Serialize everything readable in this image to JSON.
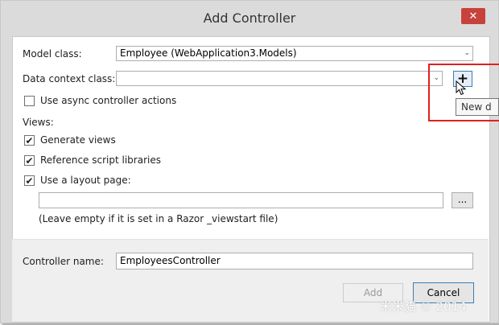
{
  "window": {
    "title": "Add Controller",
    "close_glyph": "✕"
  },
  "model_class": {
    "label": "Model class:",
    "value": "Employee (WebApplication3.Models)"
  },
  "data_context": {
    "label": "Data context class:",
    "value": "",
    "dropdown_glyph": "⌄",
    "new_button_glyph": "+"
  },
  "tooltip": {
    "text": "New d"
  },
  "async_actions": {
    "label": "Use async controller actions",
    "checked": false
  },
  "views": {
    "heading": "Views:",
    "generate_views": {
      "label": "Generate views",
      "checked": true
    },
    "reference_scripts": {
      "label": "Reference script libraries",
      "checked": true
    },
    "use_layout": {
      "label": "Use a layout page:",
      "checked": true
    },
    "layout_path": {
      "value": ""
    },
    "browse_label": "...",
    "hint": "(Leave empty if it is set in a Razor _viewstart file)"
  },
  "controller_name": {
    "label": "Controller name:",
    "value": "EmployeesController"
  },
  "buttons": {
    "add": "Add",
    "cancel": "Cancel"
  },
  "check_glyph": "✔",
  "watermark": "米米貓 © 2014",
  "colors": {
    "highlight": "#e02020",
    "close_button": "#c7423b",
    "accent": "#3c7fb1"
  }
}
